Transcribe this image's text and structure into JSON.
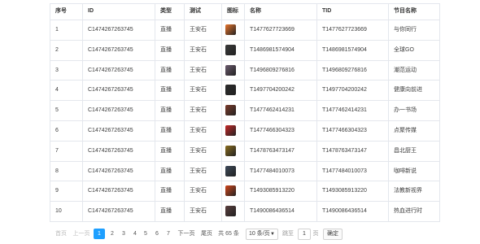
{
  "table": {
    "headers": [
      "序号",
      "ID",
      "类型",
      "测试",
      "图标",
      "名称",
      "TID",
      "节目名称"
    ],
    "rows": [
      {
        "no": "1",
        "id": "C1474267263745",
        "type": "直播",
        "test": "王安石",
        "icon": "show-thumbnail-icon",
        "name": "T1477627723669",
        "tid": "T1477627723669",
        "program": "与你同行"
      },
      {
        "no": "2",
        "id": "C1474267263745",
        "type": "直播",
        "test": "王安石",
        "icon": "show-thumbnail-icon",
        "name": "T1486981574904",
        "tid": "T1486981574904",
        "program": "全球GO"
      },
      {
        "no": "3",
        "id": "C1474267263745",
        "type": "直播",
        "test": "王安石",
        "icon": "show-thumbnail-icon",
        "name": "T1496809276816",
        "tid": "T1496809276816",
        "program": "潮范运动"
      },
      {
        "no": "4",
        "id": "C1474267263745",
        "type": "直播",
        "test": "王安石",
        "icon": "show-thumbnail-icon",
        "name": "T1497704200242",
        "tid": "T1497704200242",
        "program": "健康向前进"
      },
      {
        "no": "5",
        "id": "C1474267263745",
        "type": "直播",
        "test": "王安石",
        "icon": "show-thumbnail-icon",
        "name": "T1477462414231",
        "tid": "T1477462414231",
        "program": "办一书场"
      },
      {
        "no": "6",
        "id": "C1474267263745",
        "type": "直播",
        "test": "王安石",
        "icon": "show-thumbnail-icon",
        "name": "T1477466304323",
        "tid": "T1477466304323",
        "program": "点聚传媒"
      },
      {
        "no": "7",
        "id": "C1474267263745",
        "type": "直播",
        "test": "王安石",
        "icon": "show-thumbnail-icon",
        "name": "T1478763473147",
        "tid": "T1478763473147",
        "program": "昌北厨王"
      },
      {
        "no": "8",
        "id": "C1474267263745",
        "type": "直播",
        "test": "王安石",
        "icon": "show-thumbnail-icon",
        "name": "T1477484010073",
        "tid": "T1477484010073",
        "program": "咖啡新说"
      },
      {
        "no": "9",
        "id": "C1474267263745",
        "type": "直播",
        "test": "王安石",
        "icon": "show-thumbnail-icon",
        "name": "T1493085913220",
        "tid": "T1493085913220",
        "program": "法教新视界"
      },
      {
        "no": "10",
        "id": "C1474267263745",
        "type": "直播",
        "test": "王安石",
        "icon": "show-thumbnail-icon",
        "name": "T1490086436514",
        "tid": "T1490086436514",
        "program": "热血进行时"
      }
    ]
  },
  "pagination": {
    "first": "首页",
    "prev": "上一页",
    "pages": [
      "1",
      "2",
      "3",
      "4",
      "5",
      "6",
      "7"
    ],
    "current_page": "1",
    "next": "下一页",
    "last": "尾页",
    "total": "共 65 条",
    "page_size": "10 条/页",
    "goto_prefix": "跳至",
    "goto_value": "1",
    "goto_suffix": "页",
    "confirm": "确定"
  },
  "colors": {
    "active_page": "#1e9fff",
    "grid_line": "#e4e7ed",
    "thumbs": [
      "#e8742c",
      "#3a3a3a",
      "#6b5b6e",
      "#2b2b2b",
      "#7b3b2b",
      "#c62828",
      "#8a6d1f",
      "#3d4a5a",
      "#d0451b",
      "#5a3d3d"
    ]
  }
}
